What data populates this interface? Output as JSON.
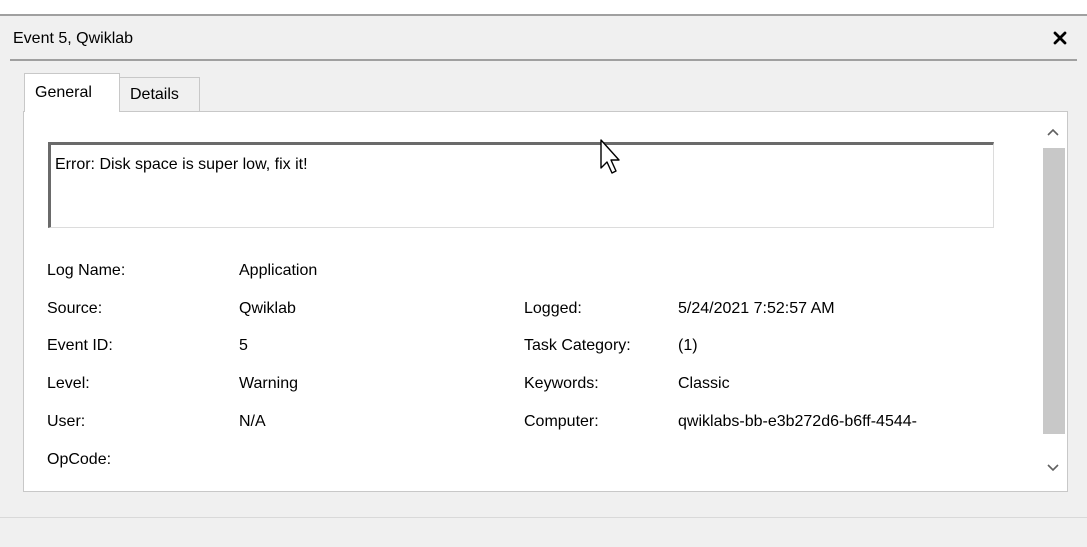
{
  "window": {
    "title": "Event 5, Qwiklab",
    "close_label": "✕"
  },
  "tabs": [
    {
      "label": "General",
      "selected": true
    },
    {
      "label": "Details",
      "selected": false
    }
  ],
  "event": {
    "description": "Error: Disk space is super low, fix it!",
    "labels": {
      "log_name": "Log Name:",
      "source": "Source:",
      "event_id": "Event ID:",
      "level": "Level:",
      "user": "User:",
      "opcode": "OpCode:",
      "logged": "Logged:",
      "task_category": "Task Category:",
      "keywords": "Keywords:",
      "computer": "Computer:"
    },
    "values": {
      "log_name": "Application",
      "source": "Qwiklab",
      "event_id": "5",
      "level": "Warning",
      "user": "N/A",
      "opcode": "",
      "logged": "5/24/2021 7:52:57 AM",
      "task_category": "(1)",
      "keywords": "Classic",
      "computer": "qwiklabs-bb-e3b272d6-b6ff-4544-"
    }
  },
  "icons": {
    "close": "close-icon",
    "scroll_up": "chevron-up-icon",
    "scroll_down": "chevron-down-icon",
    "cursor": "mouse-pointer-icon"
  }
}
